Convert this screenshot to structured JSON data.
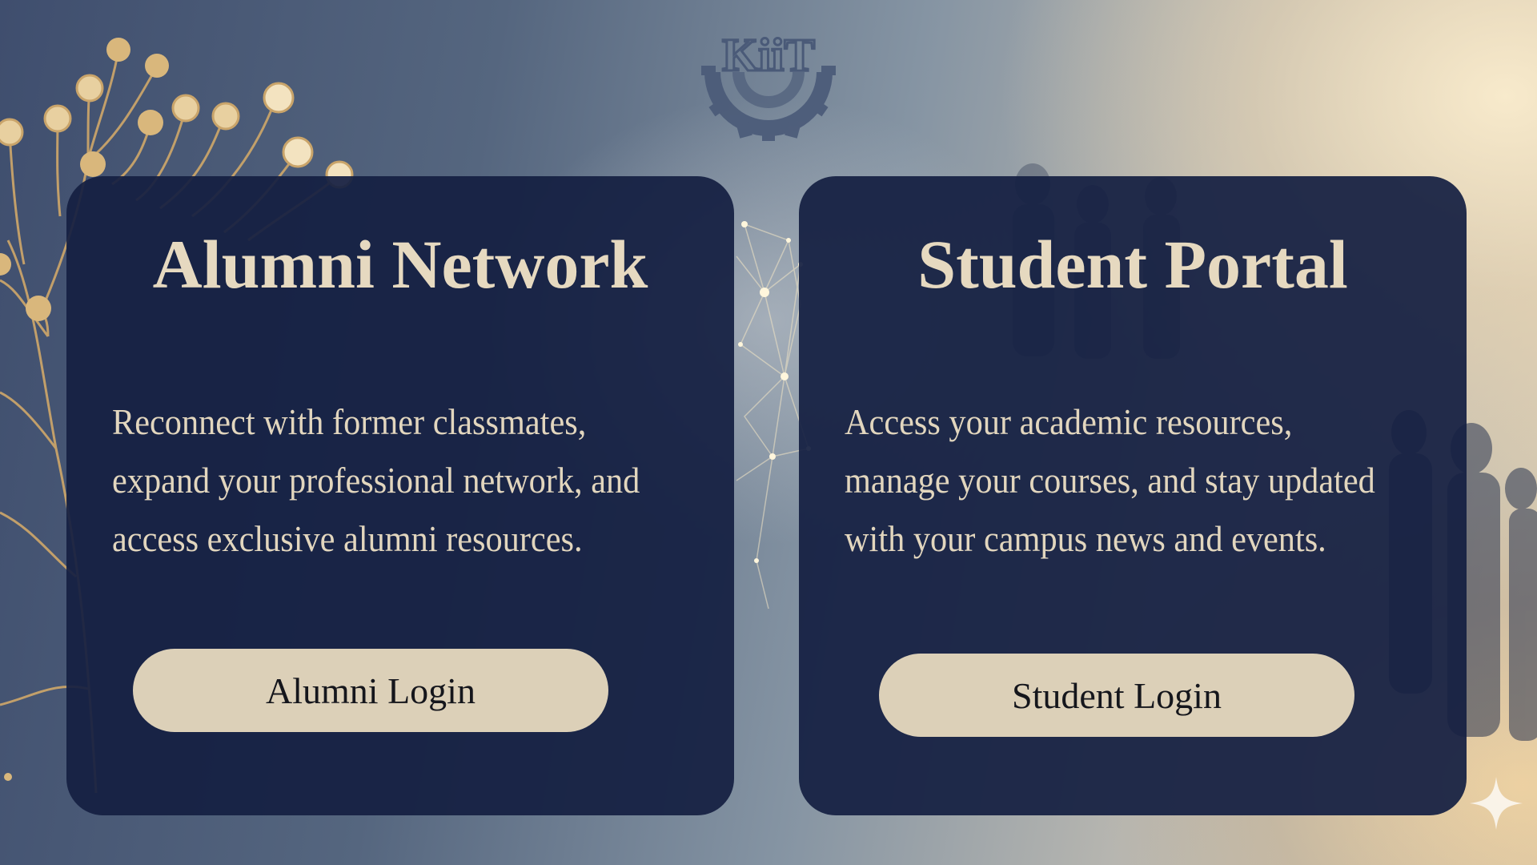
{
  "logo": {
    "text": "KiiT"
  },
  "alumni_card": {
    "title": "Alumni Network",
    "description": "Reconnect with former classmates,\nexpand your professional network, and\naccess exclusive alumni resources.",
    "button_label": "Alumni Login"
  },
  "student_card": {
    "title": "Student Portal",
    "description": "Access your academic resources,\nmanage your courses, and stay updated\nwith your campus news and events.",
    "button_label": "Student Login"
  },
  "colors": {
    "card_bg": "#141f42",
    "title": "#e6d9c0",
    "button_bg": "#dcd0b8",
    "button_text": "#15161c"
  }
}
